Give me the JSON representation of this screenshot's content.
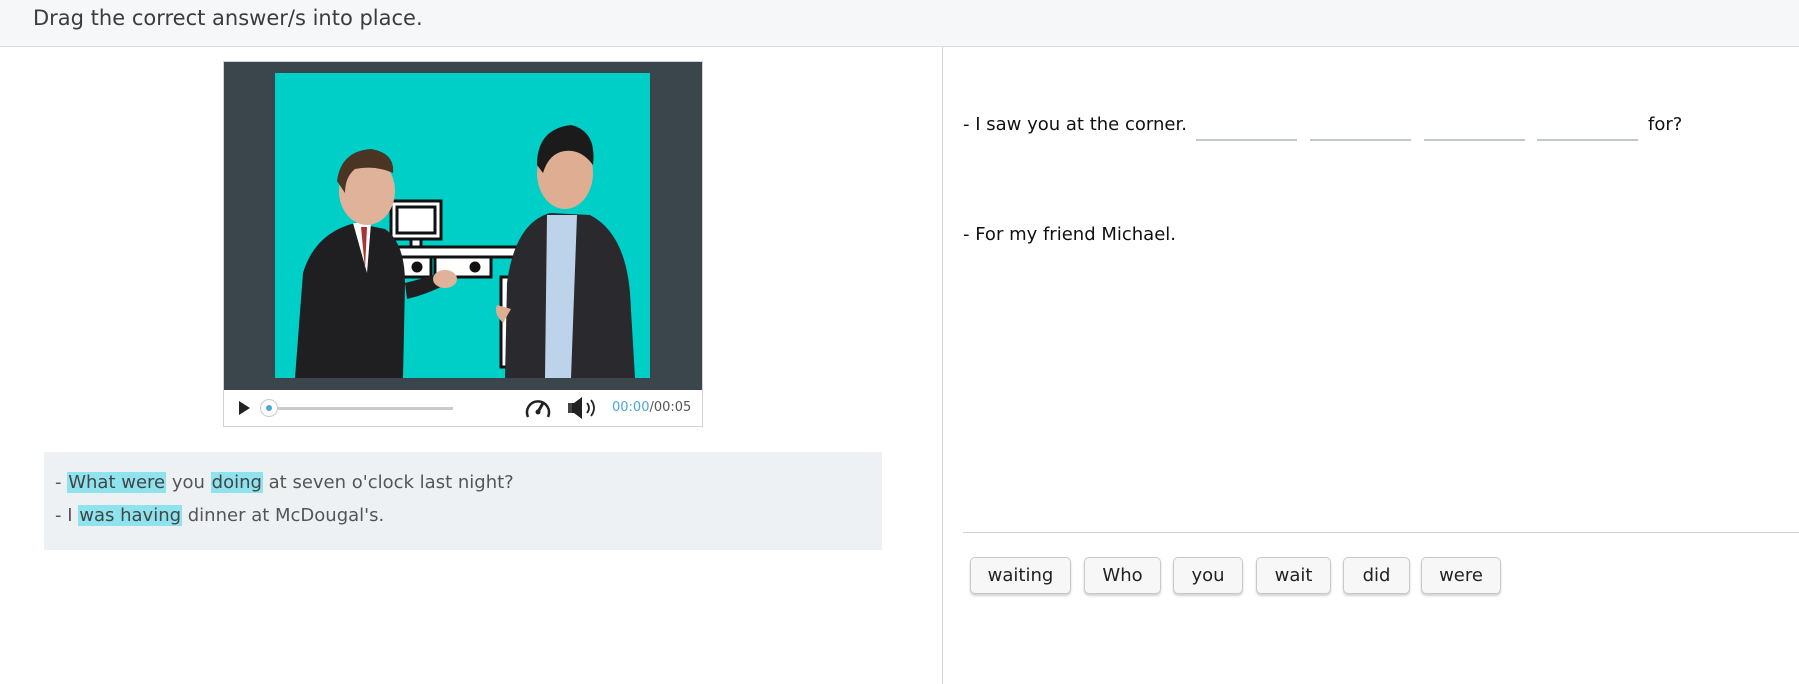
{
  "header": {
    "instruction": "Drag the correct answer/s into place."
  },
  "player": {
    "time_current": "00:00",
    "time_separator": "/",
    "time_duration": "00:05",
    "progress": 0,
    "icons": [
      "play-icon",
      "speed-icon",
      "volume-icon"
    ],
    "accent_color": "#4aa8d8",
    "screen_color": "#00cfc8"
  },
  "transcript": {
    "line1": {
      "prefix": "- ",
      "hl1": "What were",
      "mid1": " you ",
      "hl2": "doing",
      "rest": " at seven o'clock last night?"
    },
    "line2": {
      "prefix": "- I ",
      "hl1": "was having",
      "rest": " dinner at McDougal's."
    },
    "highlight_color": "#8fe3ee"
  },
  "exercise": {
    "line1_prefix": "- I saw you at the corner.",
    "line1_suffix": "for?",
    "blank_count": 4,
    "line2": "- For my friend Michael."
  },
  "word_bank": [
    "waiting",
    "Who",
    "you",
    "wait",
    "did",
    "were"
  ]
}
